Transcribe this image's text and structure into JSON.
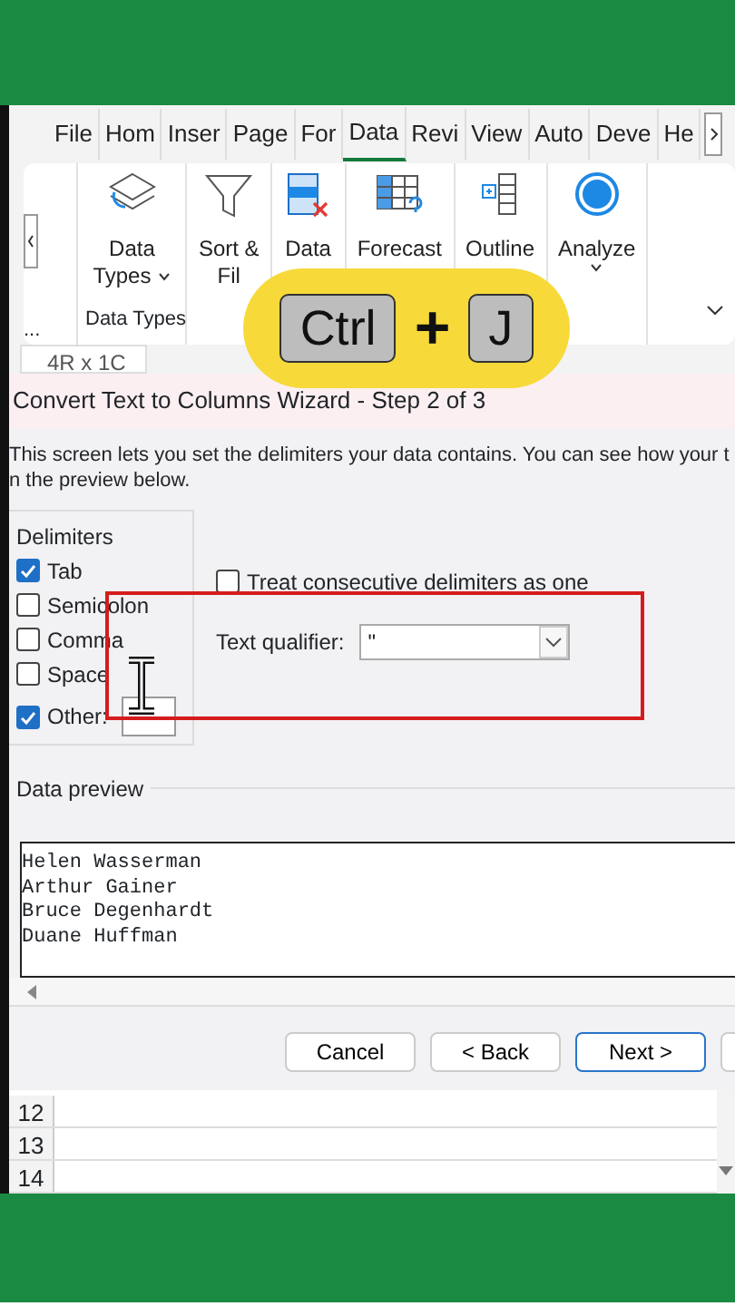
{
  "ribbon_tabs": [
    {
      "label": "File",
      "selected": false
    },
    {
      "label": "Hom",
      "selected": false
    },
    {
      "label": "Inser",
      "selected": false
    },
    {
      "label": "Page",
      "selected": false
    },
    {
      "label": "For",
      "selected": false
    },
    {
      "label": "Data",
      "selected": true
    },
    {
      "label": "Revi",
      "selected": false
    },
    {
      "label": "View",
      "selected": false
    },
    {
      "label": "Auto",
      "selected": false
    },
    {
      "label": "Deve",
      "selected": false
    },
    {
      "label": "He",
      "selected": false
    }
  ],
  "ribbon_cut_group_label": "...",
  "ribbon_commands": [
    {
      "kind": "data-types",
      "lines": [
        "Data",
        "Types"
      ]
    },
    {
      "kind": "sort-filter",
      "lines": [
        "Sort &",
        "Fil"
      ]
    },
    {
      "kind": "data-tools",
      "lines": [
        "Data"
      ]
    },
    {
      "kind": "forecast",
      "lines": [
        "Forecast"
      ]
    },
    {
      "kind": "outline",
      "lines": [
        "Outline"
      ]
    },
    {
      "kind": "analyze",
      "lines": [
        "Analyze"
      ]
    }
  ],
  "ribbon_group_label": "Data Types",
  "name_box": "4R x 1C",
  "shortcut_overlay": {
    "keys": [
      "Ctrl",
      "J"
    ],
    "joiner": "+"
  },
  "dialog": {
    "title": "Convert Text to Columns Wizard - Step 2 of 3",
    "intro": [
      "This screen lets you set the delimiters your data contains.  You can see how your t",
      "n the preview below."
    ],
    "delimiters": {
      "title": "Delimiters",
      "options": [
        {
          "label": "Tab",
          "checked": true,
          "kind": "checkbox"
        },
        {
          "label": "Semicolon",
          "checked": false,
          "kind": "checkbox"
        },
        {
          "label": "Comma",
          "checked": false,
          "kind": "checkbox"
        },
        {
          "label": "Space",
          "checked": false,
          "kind": "checkbox"
        },
        {
          "label": "Other:",
          "checked": true,
          "kind": "other"
        }
      ]
    },
    "consecutive": {
      "label": "Treat consecutive delimiters as one",
      "checked": false
    },
    "text_qualifier": {
      "label": "Text qualifier:",
      "value": "\""
    },
    "preview": {
      "title": "Data preview",
      "lines": [
        "Helen Wasserman",
        "Arthur Gainer",
        "Bruce Degenhardt",
        "Duane Huffman"
      ]
    },
    "buttons": [
      {
        "label": "Cancel",
        "primary": false
      },
      {
        "label": "< Back",
        "primary": false
      },
      {
        "label": "Next >",
        "primary": true
      }
    ]
  },
  "sheet_rows": [
    "12",
    "13",
    "14"
  ]
}
